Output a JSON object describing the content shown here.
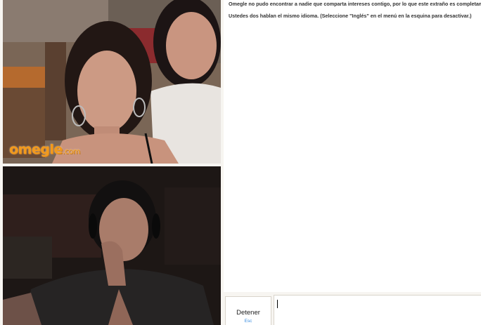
{
  "stranger_video": {
    "logo_text": "omegle",
    "logo_suffix": ".com"
  },
  "chat_log": {
    "messages": [
      "Omegle no pudo encontrar a nadie que comparta intereses contigo, por lo que este extraño es completamente aleatorio. Prueba agregar más intereses!",
      "Ustedes dos hablan el mismo idioma. (Seleccione \"Inglés\" en el menú en la esquina para desactivar.)"
    ]
  },
  "controls": {
    "stop_label": "Detener",
    "stop_hint": "Esc",
    "message_value": ""
  },
  "colors": {
    "logo": "#f29a1c",
    "hint": "#3b8ee0",
    "page_bg": "#f7f5f1"
  }
}
